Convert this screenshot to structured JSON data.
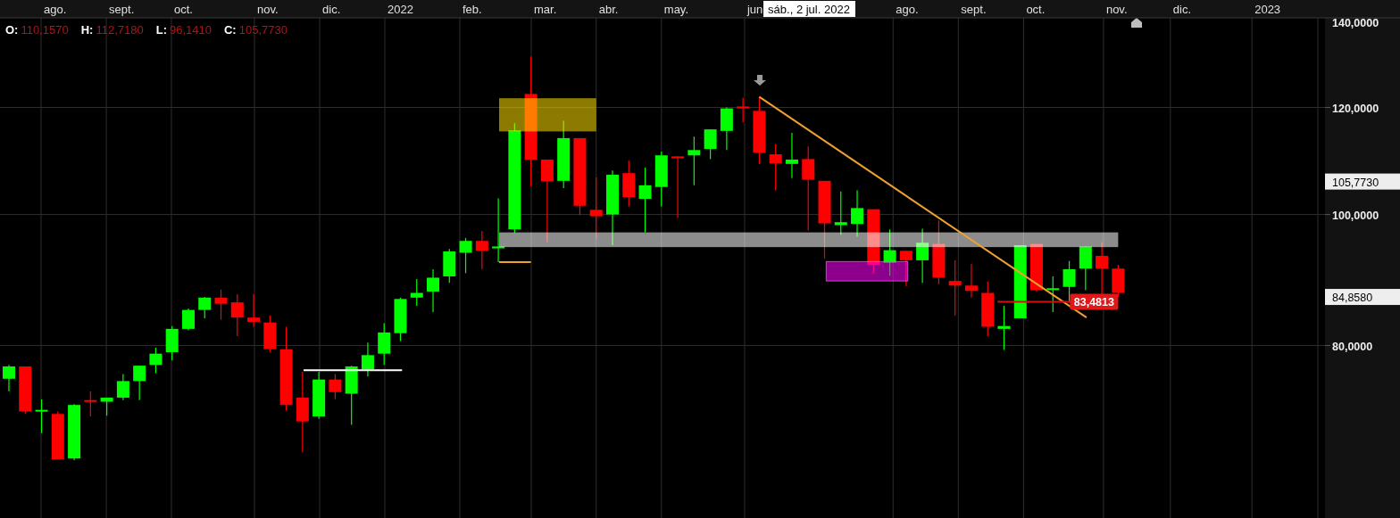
{
  "ohlc": [
    {
      "key": "O:",
      "value": "110,1570"
    },
    {
      "key": "H:",
      "value": "112,7180"
    },
    {
      "key": "L:",
      "value": "96,1410"
    },
    {
      "key": "C:",
      "value": "105,7730"
    }
  ],
  "date_tooltip": "sáb., 2 jul. 2022",
  "chart": {
    "month_labels": [
      "ago.",
      "sept.",
      "oct.",
      "nov.",
      "dic.",
      "2022",
      "feb.",
      "mar.",
      "abr.",
      "may.",
      "jun",
      "ago.",
      "sept.",
      "oct.",
      "nov.",
      "dic.",
      "2023"
    ],
    "axis_labels": [
      "140,0000",
      "120,0000",
      "100,0000",
      "80,0000"
    ],
    "price_labels": [
      "105,7730",
      "84,8580"
    ],
    "price_tag": "83,4813"
  }
}
